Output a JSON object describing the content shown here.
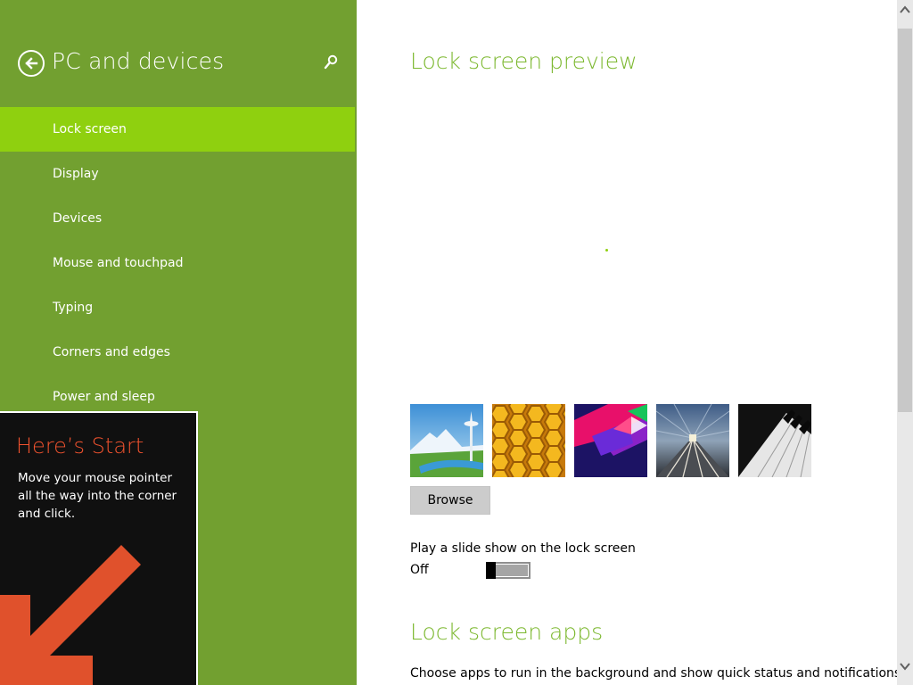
{
  "colors": {
    "left_pane": "#72a030",
    "selected_item": "#8fd00f",
    "accent_title": "#7cb82f",
    "tip_background": "#101010",
    "tip_title": "#f0522e",
    "tip_arrow": "#e0512c"
  },
  "header": {
    "back_icon": "back-arrow-circle-icon",
    "title": "PC and devices",
    "search_icon": "search-icon"
  },
  "nav": {
    "items": [
      {
        "label": "Lock screen",
        "selected": true
      },
      {
        "label": "Display",
        "selected": false
      },
      {
        "label": "Devices",
        "selected": false
      },
      {
        "label": "Mouse and touchpad",
        "selected": false
      },
      {
        "label": "Typing",
        "selected": false
      },
      {
        "label": "Corners and edges",
        "selected": false
      },
      {
        "label": "Power and sleep",
        "selected": false
      }
    ]
  },
  "tip": {
    "title": "Here’s Start",
    "body": "Move your mouse pointer all the way into the corner and click.",
    "arrow_icon": "down-left-arrow-icon"
  },
  "main": {
    "preview_title": "Lock screen preview",
    "thumbnails": [
      {
        "name": "mountain-needle-thumbnail"
      },
      {
        "name": "honeycomb-thumbnail"
      },
      {
        "name": "geometric-shapes-thumbnail"
      },
      {
        "name": "train-tunnel-thumbnail"
      },
      {
        "name": "piano-keys-thumbnail"
      }
    ],
    "browse_label": "Browse",
    "slideshow": {
      "label": "Play a slide show on the lock screen",
      "state": "Off",
      "enabled": false
    },
    "apps_title": "Lock screen apps",
    "apps_description": "Choose apps to run in the background and show quick status and notifications,"
  },
  "scrollbar": {
    "up_icon": "scroll-up-arrow-icon",
    "down_icon": "scroll-down-arrow-icon"
  }
}
